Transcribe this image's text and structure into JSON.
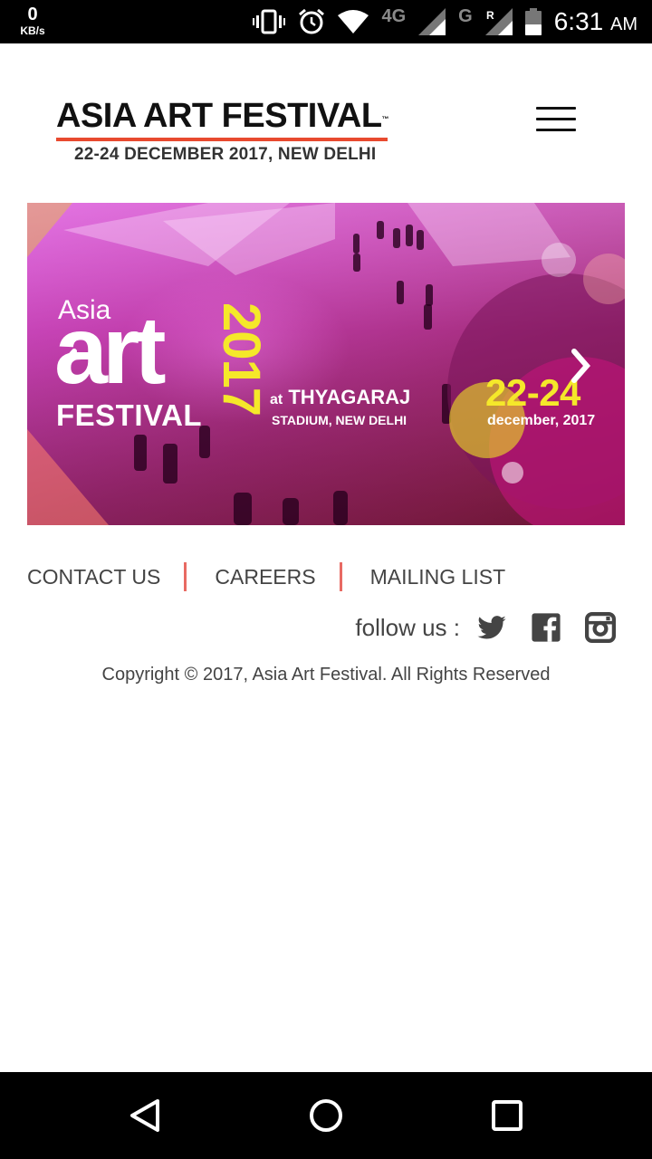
{
  "status_bar": {
    "data_rate": "0",
    "data_unit": "KB/s",
    "network_type": "4G",
    "network_type_2": "G",
    "roaming": "R",
    "time": "6:31",
    "ampm": "AM"
  },
  "header": {
    "logo_title": "ASIA ART FESTIVAL",
    "logo_tm": "™",
    "logo_subtitle": "22-24 DECEMBER 2017, NEW DELHI",
    "accent_color": "#e84a2f"
  },
  "banner": {
    "asia": "Asia",
    "art": "art",
    "festival": "FESTIVAL",
    "year": "2017",
    "at": "at",
    "venue_name": "THYAGARAJ",
    "venue_location": "STADIUM, NEW DELHI",
    "dates": "22-24",
    "month_year": "december, 2017"
  },
  "footer": {
    "links": [
      "CONTACT US",
      "CAREERS",
      "MAILING LIST"
    ],
    "separator_color": "#e86a63",
    "follow_label": "follow us :",
    "social": [
      "twitter-icon",
      "facebook-icon",
      "instagram-icon"
    ],
    "copyright": "Copyright © 2017, Asia Art Festival. All Rights Reserved"
  },
  "nav_bar": {
    "buttons": [
      "back-icon",
      "home-icon",
      "recents-icon"
    ]
  }
}
